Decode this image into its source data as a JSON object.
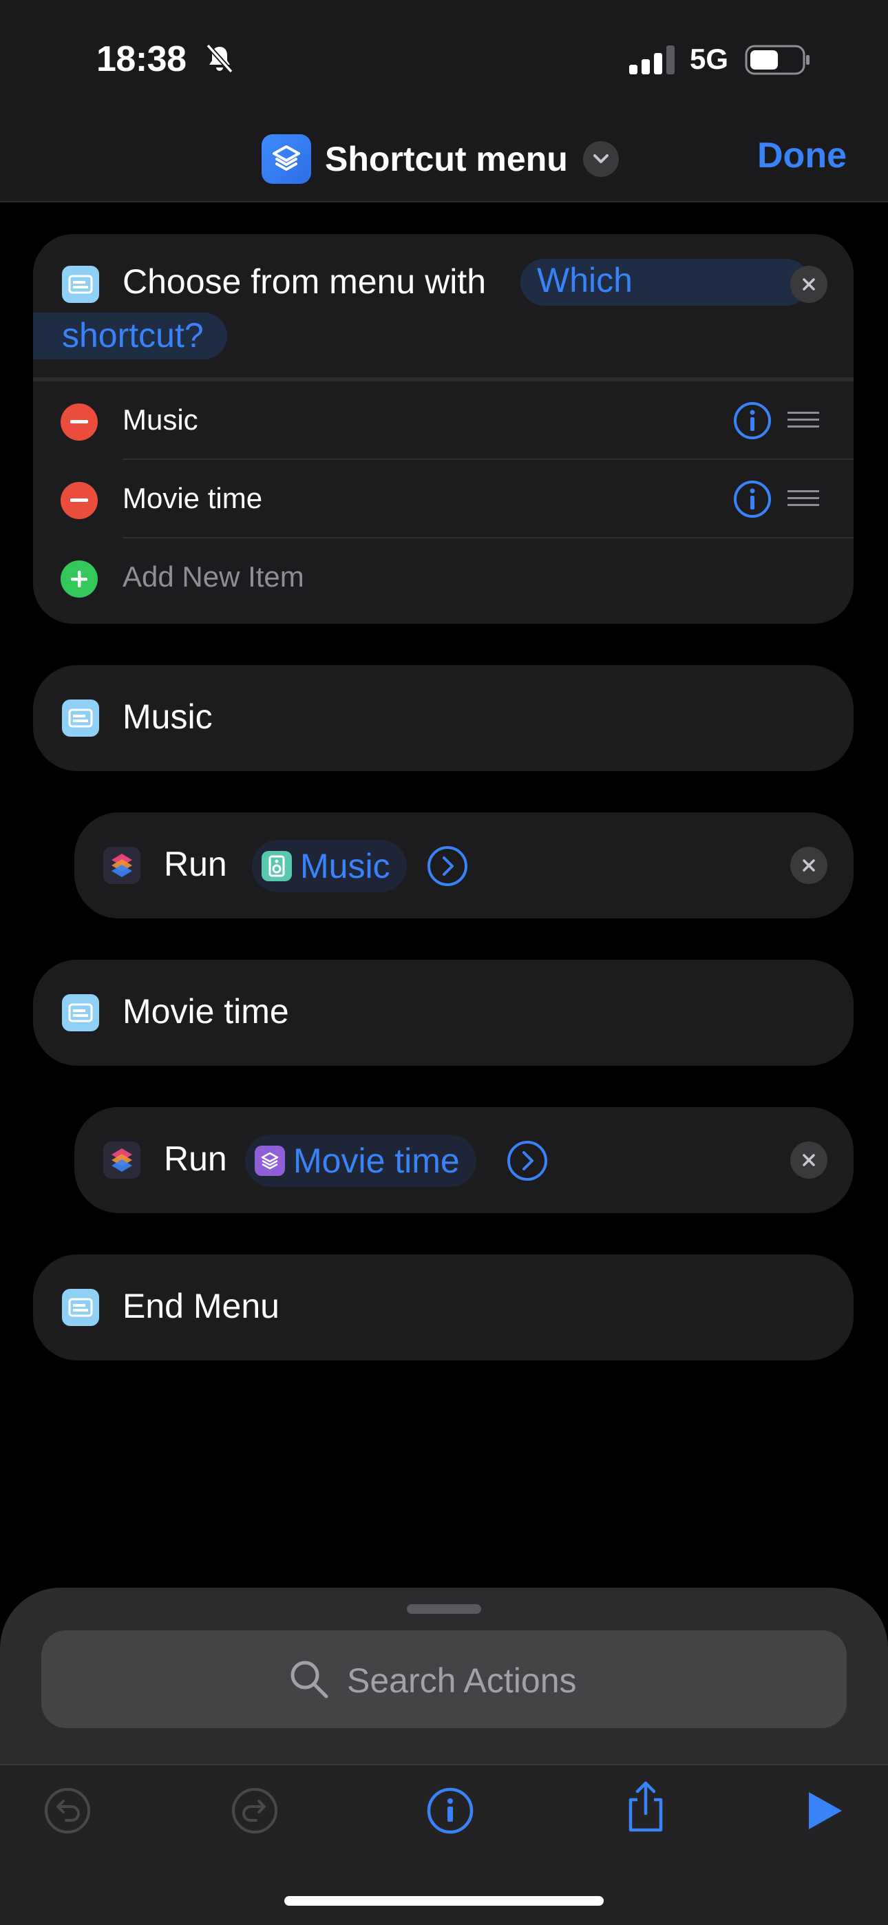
{
  "status_bar": {
    "time": "18:38",
    "network": "5G"
  },
  "nav": {
    "title": "Shortcut menu",
    "done_label": "Done"
  },
  "menu_action": {
    "prefix": "Choose from menu with",
    "prompt_line1": "Which",
    "prompt_line2": "shortcut?",
    "items": [
      {
        "label": "Music"
      },
      {
        "label": "Movie time"
      }
    ],
    "add_item_label": "Add New Item"
  },
  "blocks": {
    "case_music": "Music",
    "run_music": {
      "verb": "Run",
      "shortcut": "Music"
    },
    "case_movie": "Movie time",
    "run_movie": {
      "verb": "Run",
      "shortcut": "Movie time"
    },
    "end_menu": "End Menu"
  },
  "bottom_sheet": {
    "search_placeholder": "Search Actions"
  },
  "colors": {
    "accent": "#3a82f7",
    "destructive": "#eb4d3d",
    "add": "#34c759",
    "music_chip": "#5ac8b0",
    "movie_chip": "#8e5fd6"
  },
  "icons": [
    "bell-slash-icon",
    "signal-icon",
    "battery-icon",
    "shortcuts-app-icon",
    "chevron-down-icon",
    "menu-action-icon",
    "close-icon",
    "minus-icon",
    "plus-icon",
    "info-icon",
    "drag-handle-icon",
    "shortcuts-run-icon",
    "music-speaker-icon",
    "layers-icon",
    "chevron-right-circle-icon",
    "search-icon",
    "undo-icon",
    "redo-icon",
    "share-icon",
    "play-icon"
  ]
}
